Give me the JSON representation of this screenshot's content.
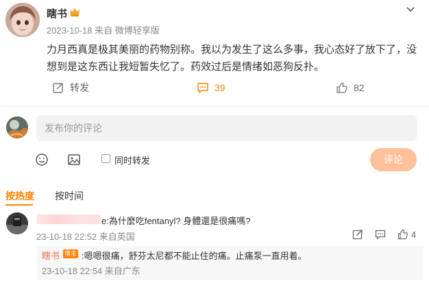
{
  "post": {
    "author": "瞎书",
    "meta": "2023-10-18  来自 微博轻享版",
    "text": "力月西真是极其美丽的药物别称。我以为发生了这么多事，我心态好了放下了，没想到是这东西让我短暂失忆了。药效过后是情绪如恶狗反扑。",
    "repost_label": "转发",
    "comment_count": "39",
    "like_count": "82",
    "colors": {
      "accent": "#ff8200",
      "reply_name": "#eb7350"
    }
  },
  "compose": {
    "placeholder": "发布你的评论",
    "sync_label": "同时转发",
    "submit_label": "评论"
  },
  "tabs": {
    "hot": "按热度",
    "time": "按时间"
  },
  "comments": [
    {
      "text": "e:為什麼吃fentanyl? 身體還是很痛嗎?",
      "meta": "23-10-18 22:52  来自英国",
      "like_count": "4",
      "reply": {
        "name": "瞎书",
        "badge": "博主",
        "text": ":嗯嗯很痛，舒芬太尼都不能止住的痛。止痛泵一直用着。",
        "meta": "23-10-18 22:54  来自广东"
      }
    }
  ]
}
